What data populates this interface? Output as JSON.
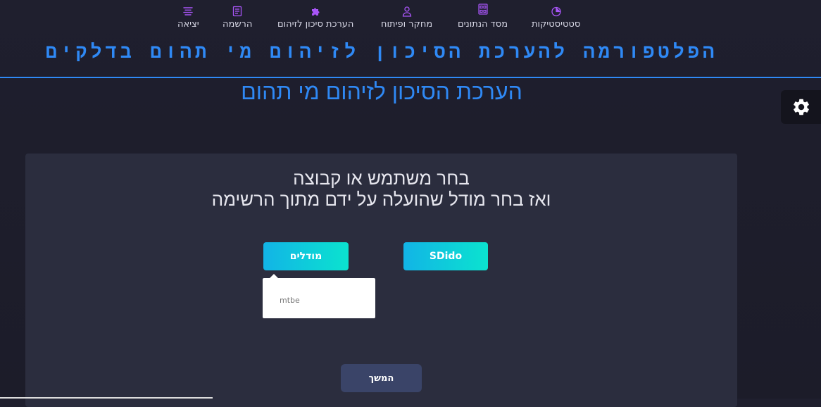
{
  "nav": {
    "items": [
      {
        "label": "יציאה",
        "icon": "align-center-icon"
      },
      {
        "label": "הרשמה",
        "icon": "document-icon"
      },
      {
        "label": "הערכת סיכון לזיהום",
        "icon": "puzzle-icon"
      },
      {
        "label": "מחקר ופיתוח",
        "icon": "user-icon"
      },
      {
        "label": "מסד הנתונים",
        "icon": "database-icon"
      },
      {
        "label": "סטטיסטיקות",
        "icon": "pie-chart-icon"
      }
    ]
  },
  "header": {
    "platform_title": "הפלטפורמה להערכת הסיכון לזיהום מי תהום בדלקים",
    "page_title": "הערכת הסיכון לזיהום מי תהום"
  },
  "card": {
    "line1": "בחר משתמש או קבוצה",
    "line2": "ואז בחר מודל שהועלה על ידם מתוך הרשימה",
    "models_button": "מודלים",
    "user_button": "SDido",
    "dropdown_items": [
      "mtbe"
    ],
    "continue_button": "המשך"
  },
  "colors": {
    "accent": "#2f89f5",
    "nav_icon": "#a855f7",
    "button_gradient_start": "#12b4e6",
    "button_gradient_end": "#0be3cf",
    "continue_button": "#3a4468"
  }
}
